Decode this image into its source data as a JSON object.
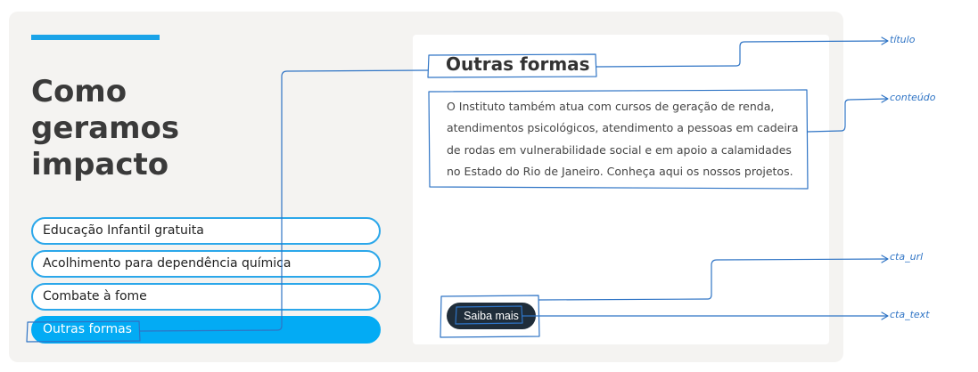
{
  "headline": [
    "Como",
    "geramos",
    "impacto"
  ],
  "nav": {
    "items": [
      {
        "label": "Educação Infantil gratuita",
        "active": false
      },
      {
        "label": "Acolhimento para dependência química",
        "active": false
      },
      {
        "label": "Combate à fome",
        "active": false
      },
      {
        "label": "Outras formas",
        "active": true
      }
    ]
  },
  "card": {
    "title": "Outras formas",
    "content": "O Instituto também atua com cursos de geração de renda, atendimentos psicológicos, atendimento a pessoas em cadeira de rodas em vulnerabilidade social e em apoio a calamidades no Estado do Rio de Janeiro. Conheça aqui os nossos projetos.",
    "cta_text": "Saiba mais"
  },
  "annotations": {
    "titulo": "título",
    "conteudo": "conteúdo",
    "cta_url": "cta_url",
    "cta_text": "cta_text"
  },
  "colors": {
    "accent": "#03abf4",
    "pill_border": "#2ba7ea",
    "cta_bg": "#1f2d3a",
    "annotation": "#2f74c5"
  }
}
